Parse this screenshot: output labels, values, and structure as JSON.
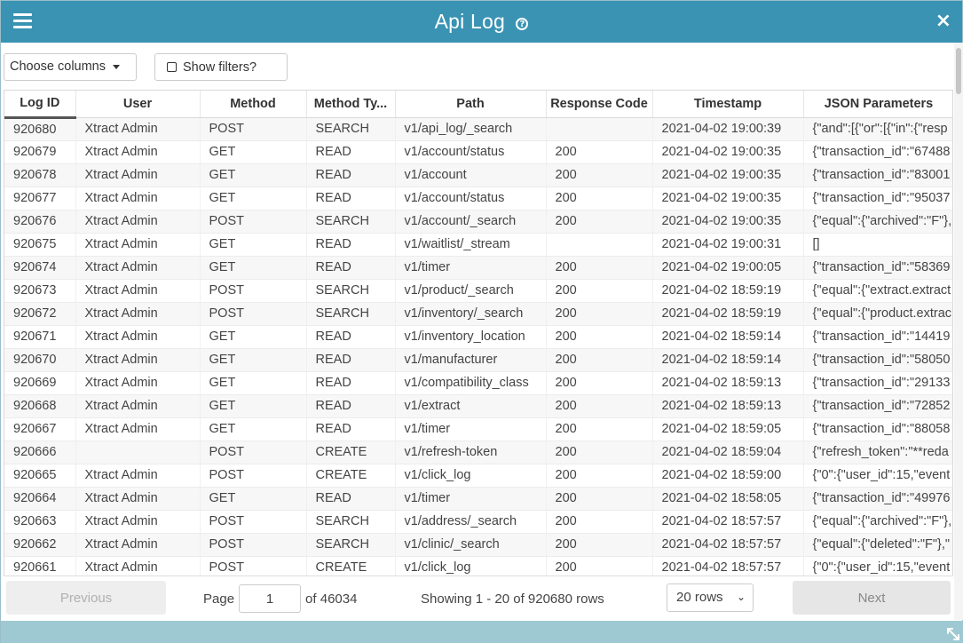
{
  "window": {
    "title": "Api Log",
    "help_glyph": "?",
    "close_glyph": "×"
  },
  "toolbar": {
    "choose_columns_label": "Choose columns",
    "show_filters_label": "Show filters?"
  },
  "table": {
    "columns": [
      "Log ID",
      "User",
      "Method",
      "Method Ty...",
      "Path",
      "Response Code",
      "Timestamp",
      "JSON Parameters"
    ],
    "rows": [
      [
        "920680",
        "Xtract Admin",
        "POST",
        "SEARCH",
        "v1/api_log/_search",
        "",
        "2021-04-02 19:00:39",
        "{\"and\":[{\"or\":[{\"in\":{\"resp"
      ],
      [
        "920679",
        "Xtract Admin",
        "GET",
        "READ",
        "v1/account/status",
        "200",
        "2021-04-02 19:00:35",
        "{\"transaction_id\":\"67488"
      ],
      [
        "920678",
        "Xtract Admin",
        "GET",
        "READ",
        "v1/account",
        "200",
        "2021-04-02 19:00:35",
        "{\"transaction_id\":\"83001"
      ],
      [
        "920677",
        "Xtract Admin",
        "GET",
        "READ",
        "v1/account/status",
        "200",
        "2021-04-02 19:00:35",
        "{\"transaction_id\":\"95037"
      ],
      [
        "920676",
        "Xtract Admin",
        "POST",
        "SEARCH",
        "v1/account/_search",
        "200",
        "2021-04-02 19:00:35",
        "{\"equal\":{\"archived\":\"F\"},"
      ],
      [
        "920675",
        "Xtract Admin",
        "GET",
        "READ",
        "v1/waitlist/_stream",
        "",
        "2021-04-02 19:00:31",
        "[]"
      ],
      [
        "920674",
        "Xtract Admin",
        "GET",
        "READ",
        "v1/timer",
        "200",
        "2021-04-02 19:00:05",
        "{\"transaction_id\":\"58369"
      ],
      [
        "920673",
        "Xtract Admin",
        "POST",
        "SEARCH",
        "v1/product/_search",
        "200",
        "2021-04-02 18:59:19",
        "{\"equal\":{\"extract.extract"
      ],
      [
        "920672",
        "Xtract Admin",
        "POST",
        "SEARCH",
        "v1/inventory/_search",
        "200",
        "2021-04-02 18:59:19",
        "{\"equal\":{\"product.extrac"
      ],
      [
        "920671",
        "Xtract Admin",
        "GET",
        "READ",
        "v1/inventory_location",
        "200",
        "2021-04-02 18:59:14",
        "{\"transaction_id\":\"14419"
      ],
      [
        "920670",
        "Xtract Admin",
        "GET",
        "READ",
        "v1/manufacturer",
        "200",
        "2021-04-02 18:59:14",
        "{\"transaction_id\":\"58050"
      ],
      [
        "920669",
        "Xtract Admin",
        "GET",
        "READ",
        "v1/compatibility_class",
        "200",
        "2021-04-02 18:59:13",
        "{\"transaction_id\":\"29133"
      ],
      [
        "920668",
        "Xtract Admin",
        "GET",
        "READ",
        "v1/extract",
        "200",
        "2021-04-02 18:59:13",
        "{\"transaction_id\":\"72852"
      ],
      [
        "920667",
        "Xtract Admin",
        "GET",
        "READ",
        "v1/timer",
        "200",
        "2021-04-02 18:59:05",
        "{\"transaction_id\":\"88058"
      ],
      [
        "920666",
        "",
        "POST",
        "CREATE",
        "v1/refresh-token",
        "200",
        "2021-04-02 18:59:04",
        "{\"refresh_token\":\"**reda"
      ],
      [
        "920665",
        "Xtract Admin",
        "POST",
        "CREATE",
        "v1/click_log",
        "200",
        "2021-04-02 18:59:00",
        "{\"0\":{\"user_id\":15,\"event"
      ],
      [
        "920664",
        "Xtract Admin",
        "GET",
        "READ",
        "v1/timer",
        "200",
        "2021-04-02 18:58:05",
        "{\"transaction_id\":\"49976"
      ],
      [
        "920663",
        "Xtract Admin",
        "POST",
        "SEARCH",
        "v1/address/_search",
        "200",
        "2021-04-02 18:57:57",
        "{\"equal\":{\"archived\":\"F\"},"
      ],
      [
        "920662",
        "Xtract Admin",
        "POST",
        "SEARCH",
        "v1/clinic/_search",
        "200",
        "2021-04-02 18:57:57",
        "{\"equal\":{\"deleted\":\"F\"},\""
      ],
      [
        "920661",
        "Xtract Admin",
        "POST",
        "CREATE",
        "v1/click_log",
        "200",
        "2021-04-02 18:57:57",
        "{\"0\":{\"user_id\":15,\"event"
      ]
    ]
  },
  "pager": {
    "previous_label": "Previous",
    "page_label": "Page",
    "page_value": "1",
    "of_label": "of 46034",
    "showing_text": "Showing 1 - 20 of 920680 rows",
    "rows_select_value": "20 rows",
    "next_label": "Next"
  },
  "colors": {
    "titlebar": "#3a93b3",
    "footer": "#9fc9d2"
  }
}
